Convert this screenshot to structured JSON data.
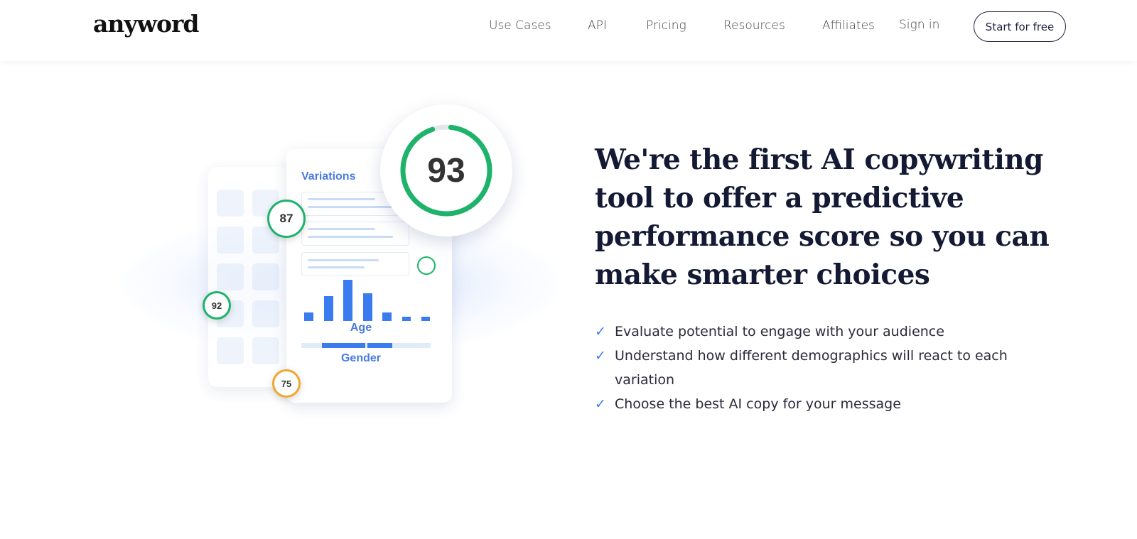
{
  "header": {
    "logo": "anyword",
    "nav": [
      "Use Cases",
      "API",
      "Pricing",
      "Resources",
      "Affiliates",
      "Sign in"
    ],
    "cta": "Start for free"
  },
  "illustration": {
    "card_title": "Variations",
    "main_score": "93",
    "scores": [
      "87",
      "92",
      "75"
    ],
    "age_label": "Age",
    "gender_label": "Gender",
    "age_bars": [
      0.2,
      0.6,
      1.0,
      0.68,
      0.2,
      0.1,
      0.1
    ],
    "colors": {
      "good": "#1db36b",
      "warn": "#f0a630",
      "accent": "#3b7bf0"
    }
  },
  "hero": {
    "headline": "We're the first AI copywriting tool to offer a predictive performance score so you can make smarter choices",
    "bullets": [
      "Evaluate potential to engage with your audience",
      "Understand how different demographics will react to each variation",
      "Choose the best AI copy for your message"
    ],
    "check_icon": "check-icon"
  }
}
